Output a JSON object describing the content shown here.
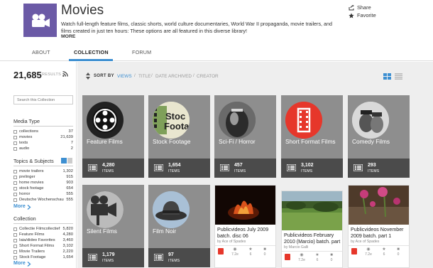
{
  "header": {
    "title": "Movies",
    "description": "Watch full-length feature films, classic shorts, world culture documentaries, World War II propaganda, movie trailers, and films created in just ten hours: These options are all featured in this diverse library!",
    "more": "MORE",
    "share": "Share",
    "favorite": "Favorite",
    "icon": "film-camera-icon",
    "icon_bg": "#6b5aa6"
  },
  "tabs": [
    {
      "label": "ABOUT"
    },
    {
      "label": "COLLECTION",
      "active": true
    },
    {
      "label": "FORUM"
    }
  ],
  "sidebar": {
    "results_count": "21,685",
    "results_label": "RESULTS",
    "search_placeholder": "Search this Collection",
    "media_type": {
      "title": "Media Type",
      "items": [
        {
          "label": "collections",
          "count": "37"
        },
        {
          "label": "movies",
          "count": "21,639"
        },
        {
          "label": "texts",
          "count": "7"
        },
        {
          "label": "audio",
          "count": "2"
        }
      ]
    },
    "topics": {
      "title": "Topics & Subjects",
      "items": [
        {
          "label": "movie trailers",
          "count": "1,302"
        },
        {
          "label": "prelinger",
          "count": "915"
        },
        {
          "label": "home movies",
          "count": "903"
        },
        {
          "label": "stock footage",
          "count": "654"
        },
        {
          "label": "horror",
          "count": "555"
        },
        {
          "label": "Deutsche Wochenschau",
          "count": "555"
        }
      ],
      "more": "More"
    },
    "collection": {
      "title": "Collection",
      "items": [
        {
          "label": "Collectie Filmcollectief",
          "count": "5,820"
        },
        {
          "label": "Feature Films",
          "count": "4,280"
        },
        {
          "label": "Iaia/dideo Favorites",
          "count": "3,460"
        },
        {
          "label": "Short Format Films",
          "count": "3,102"
        },
        {
          "label": "Movie Trailers",
          "count": "2,220"
        },
        {
          "label": "Stock Footage",
          "count": "1,654"
        }
      ],
      "more": "More"
    }
  },
  "sortbar": {
    "label": "SORT BY",
    "options": [
      "VIEWS",
      "TITLE",
      "DATE ARCHIVED",
      "CREATOR"
    ],
    "separator": "/",
    "active": "VIEWS"
  },
  "collections": [
    {
      "name": "Feature Films",
      "count": "4,280",
      "unit": "ITEMS",
      "art": "film-reel-icon"
    },
    {
      "name": "Stock Footage",
      "count": "1,654",
      "unit": "ITEMS",
      "art": "stock-footage-icon"
    },
    {
      "name": "Sci-Fi / Horror",
      "count": "457",
      "unit": "ITEMS",
      "art": "scifi-icon"
    },
    {
      "name": "Short Format Films",
      "count": "3,102",
      "unit": "ITEMS",
      "art": "filmstrip-icon"
    },
    {
      "name": "Comedy Films",
      "count": "293",
      "unit": "ITEMS",
      "art": "comedy-portrait-icon"
    },
    {
      "name": "Silent Films",
      "count": "1,179",
      "unit": "ITEMS",
      "art": "silent-film-icon"
    },
    {
      "name": "Film Noir",
      "count": "97",
      "unit": "ITEMS",
      "art": "fedora-hat-icon"
    }
  ],
  "items": [
    {
      "title": "Publicvideos July 2009 batch. disc 06",
      "by": "by Ace of Spades",
      "views": "7.2e",
      "favs": "6",
      "reviews": "0"
    },
    {
      "title": "Publicvideos February 2010 (Marcio) batch. part",
      "by": "by Marcio Galli",
      "views": "7.2e",
      "favs": "6",
      "reviews": "0"
    },
    {
      "title": "Publicvideos November 2009 batch. part 1",
      "by": "by Ace of Spades",
      "views": "7.2e",
      "favs": "6",
      "reviews": "0"
    }
  ],
  "colors": {
    "accent": "#3d8fd1",
    "tile_bg": "#8e8e8e",
    "tile_footer": "#4b4b4b",
    "page_bg": "#eeeeee",
    "red": "#e6372b"
  }
}
